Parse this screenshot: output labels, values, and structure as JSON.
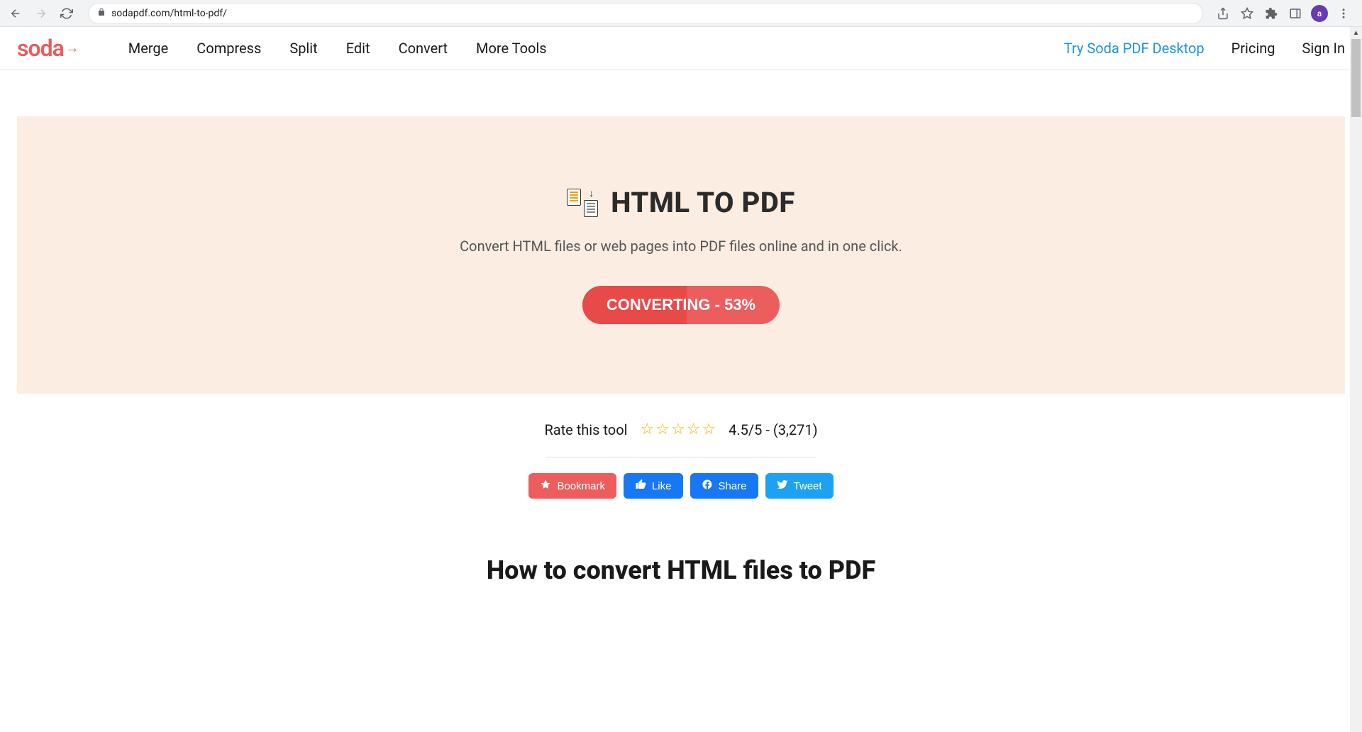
{
  "browser": {
    "url": "sodapdf.com/html-to-pdf/",
    "profile_letter": "a"
  },
  "header": {
    "logo_text": "soda",
    "nav": [
      "Merge",
      "Compress",
      "Split",
      "Edit",
      "Convert",
      "More Tools"
    ],
    "try_desktop": "Try Soda PDF Desktop",
    "pricing": "Pricing",
    "signin": "Sign In"
  },
  "hero": {
    "title": "HTML TO PDF",
    "subtitle": "Convert HTML files or web pages into PDF files online and in one click.",
    "button_label": "CONVERTING - 53%",
    "progress_percent": 53
  },
  "rating": {
    "label": "Rate this tool",
    "score_text": "4.5/5 - (3,271)"
  },
  "share": {
    "bookmark": "Bookmark",
    "like": "Like",
    "share": "Share",
    "tweet": "Tweet"
  },
  "howto": {
    "title": "How to convert HTML files to PDF"
  }
}
